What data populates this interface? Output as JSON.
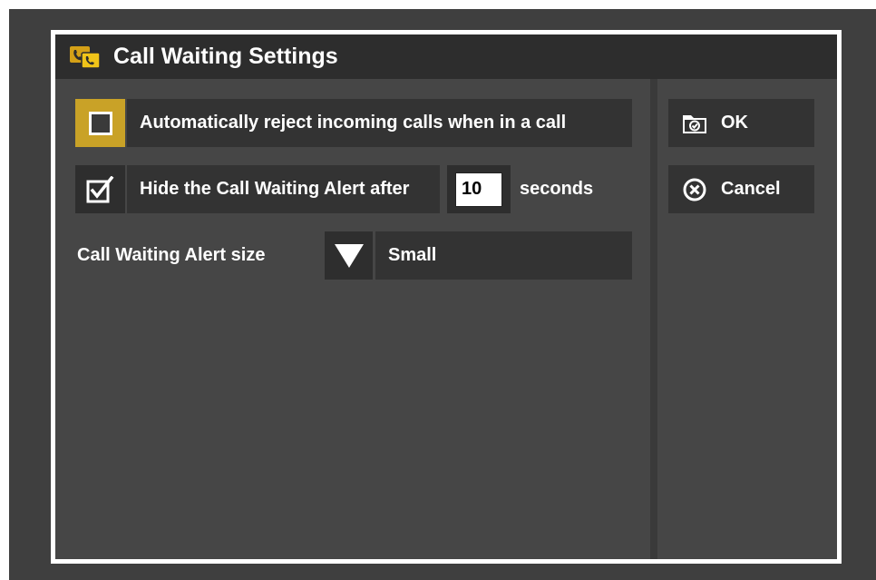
{
  "dialog": {
    "title": "Call Waiting Settings",
    "title_icon": "call-waiting-icon"
  },
  "options": {
    "auto_reject": {
      "checked": false,
      "label": "Automatically reject incoming calls when in a call"
    },
    "hide_alert": {
      "checked": true,
      "label_prefix": "Hide the Call Waiting Alert after",
      "seconds_value": "10",
      "label_suffix": "seconds"
    },
    "alert_size": {
      "label": "Call Waiting Alert size",
      "selected": "Small"
    }
  },
  "actions": {
    "ok_label": "OK",
    "ok_icon": "folder-check-icon",
    "cancel_label": "Cancel",
    "cancel_icon": "circle-x-icon"
  },
  "colors": {
    "accent": "#c9a227",
    "background": "#464646",
    "titlebar": "#2d2d2d"
  }
}
